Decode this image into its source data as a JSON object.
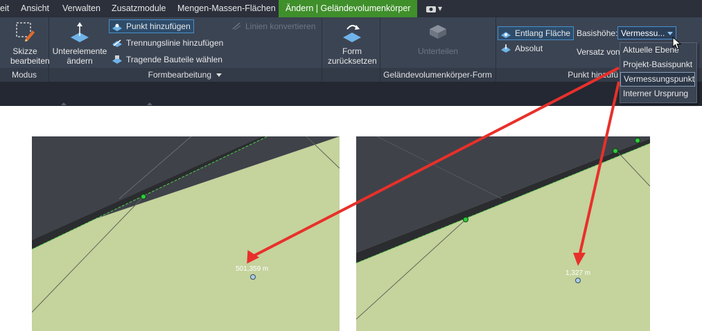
{
  "menubar": {
    "tabs": [
      "eit",
      "Ansicht",
      "Verwalten",
      "Zusatzmodule",
      "Mengen-Massen-Flächen"
    ],
    "active_tab": "Ändern | Geländevolumenkörper",
    "extra": "▾"
  },
  "ribbon": {
    "modus": {
      "button": "Skizze bearbeiten",
      "group": "Modus"
    },
    "formbearbeitung": {
      "unterelemente": "Unterelemente ändern",
      "punkt_hinzufuegen": "Punkt hinzufügen",
      "trennungslinie": "Trennungslinie hinzufügen",
      "tragende_bauteile": "Tragende Bauteile wählen",
      "linien_konvertieren": "Linien konvertieren",
      "group": "Formbearbeitung"
    },
    "gelaende_form": {
      "form_zuruecksetzen": "Form zurücksetzen",
      "unterteilen": "Unterteilen",
      "group": "Geländevolumenkörper-Form"
    },
    "punkt": {
      "entlang_flaeche": "Entlang Fläche",
      "absolut": "Absolut",
      "basishoehe_label": "Basishöhe:",
      "basishoehe_value": "Vermessu...",
      "versatz_label": "Versatz von",
      "group": "Punkt hinzufü"
    }
  },
  "dropdown_menu": {
    "items": [
      "Aktuelle Ebene",
      "Projekt-Basispunkt",
      "Vermessungspunkt",
      "Interner Ursprung"
    ],
    "hovered_index": 2
  },
  "views": {
    "left": {
      "elevation": "501,359 m"
    },
    "right": {
      "elevation": "1,327 m"
    }
  },
  "colors": {
    "accent_tab": "#3f8f2a",
    "arrow": "#e8302a",
    "terrain": "#c5d39d",
    "edge_point": "#2ecc40"
  }
}
